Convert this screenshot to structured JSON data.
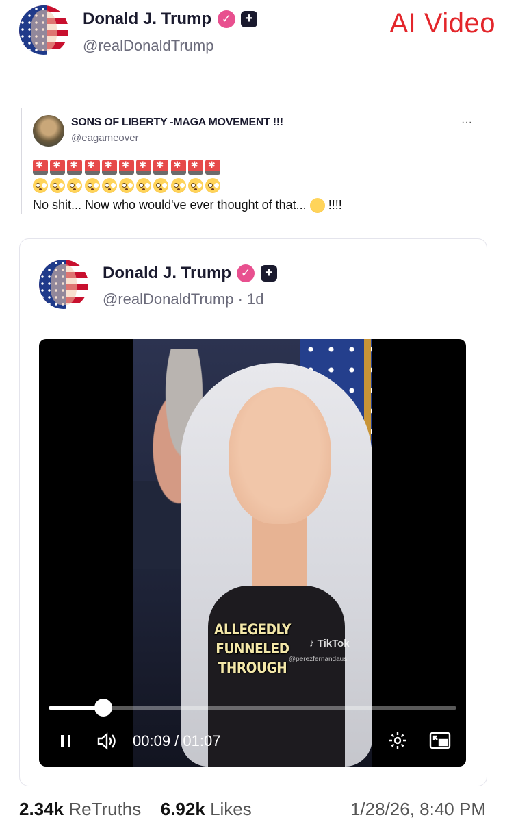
{
  "header": {
    "name": "Donald J. Trump",
    "handle": "@realDonaldTrump",
    "label": "AI Video"
  },
  "quoted": {
    "name": "SONS OF LIBERTY -MAGA MOVEMENT !!!",
    "handle": "@eagameover",
    "more": "···",
    "text": "No shit... Now who would've ever thought of that...",
    "text_suffix": "!!!!",
    "siren_count": 11,
    "flushed_count": 11
  },
  "card": {
    "name": "Donald J. Trump",
    "handle": "@realDonaldTrump · 1d"
  },
  "video": {
    "caption_line1": "ALLEGEDLY FUNNELED",
    "caption_line2": "THROUGH",
    "watermark": "TikTok",
    "watermark_user": "@perezfernandaus",
    "time": "00:09 / 01:07",
    "progress": 0.134
  },
  "stats": {
    "retruths_count": "2.34k",
    "retruths_label": "ReTruths",
    "likes_count": "6.92k",
    "likes_label": "Likes",
    "timestamp": "1/28/26, 8:40 PM"
  },
  "icons": {
    "verified": "verified-badge-icon",
    "plus": "plus-badge-icon",
    "pause": "pause-icon",
    "volume": "volume-icon",
    "settings": "gear-icon",
    "pip": "picture-in-picture-icon"
  },
  "colors": {
    "ai_label": "#e3262b",
    "verified": "#e8508f"
  }
}
